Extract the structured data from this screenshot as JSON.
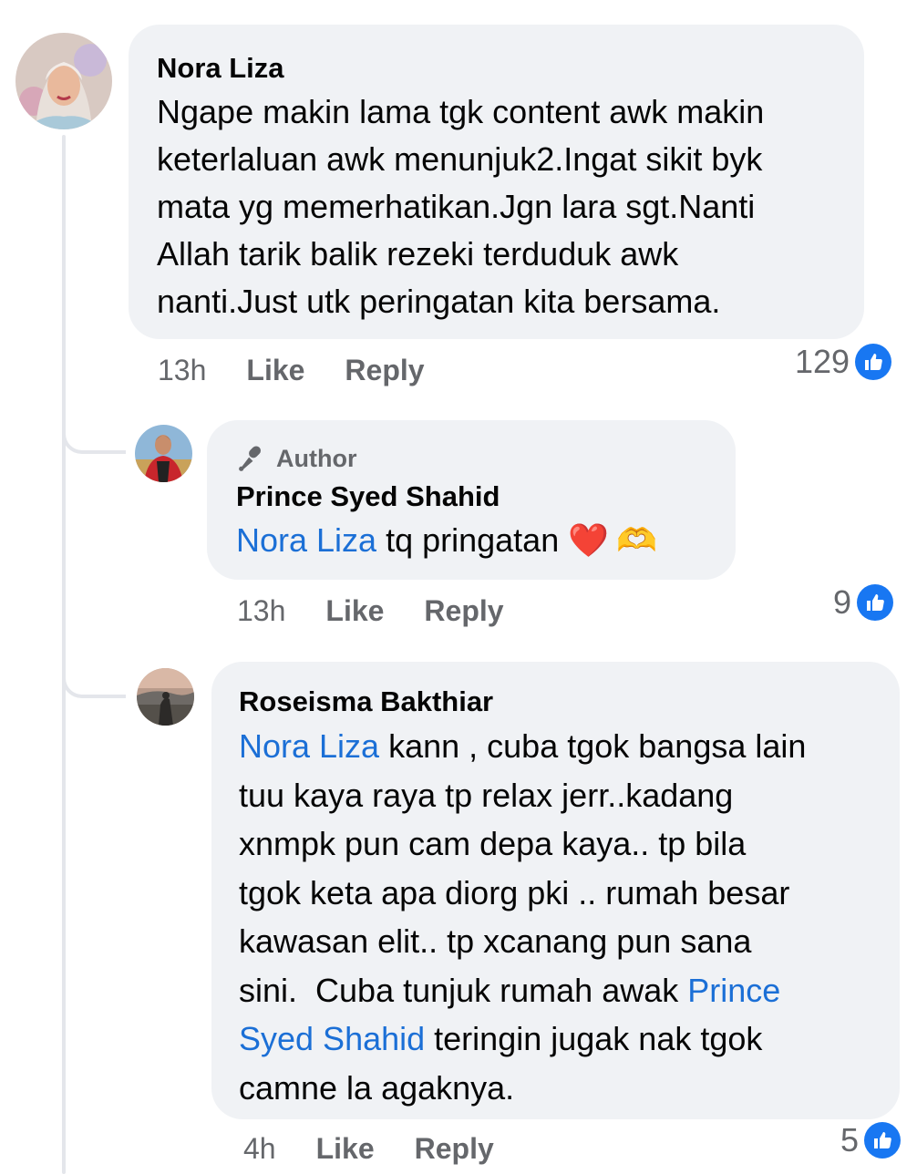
{
  "colors": {
    "bubble": "#f0f2f5",
    "mention": "#1b6fd6",
    "like_blue": "#1877f2",
    "meta": "#65676b"
  },
  "comments": [
    {
      "name": "Nora Liza",
      "lines": [
        "Ngape makin lama tgk content awk makin",
        "keterlaluan awk menunjuk2.Ingat sikit byk",
        "mata yg memerhatikan.Jgn lara sgt.Nanti",
        "Allah tarik balik rezeki terduduk awk",
        "nanti.Just utk peringatan kita bersama."
      ],
      "time": "13h",
      "like_label": "Like",
      "reply_label": "Reply",
      "reaction_count": "129"
    },
    {
      "badge": "Author",
      "badge_icon": "microphone-icon",
      "name": "Prince Syed Shahid",
      "mention": "Nora Liza",
      "text": " tq pringatan ",
      "emojis": [
        "❤️",
        "🫶"
      ],
      "time": "13h",
      "like_label": "Like",
      "reply_label": "Reply",
      "reaction_count": "9"
    },
    {
      "name": "Roseisma Bakthiar",
      "line1_mention": "Nora Liza",
      "line1_text": " kann , cuba tgok bangsa lain",
      "line2": "tuu kaya raya tp relax jerr..kadang",
      "line3": "xnmpk pun cam depa kaya.. tp bila",
      "line4": "tgok keta apa diorg pki .. rumah besar",
      "line5": "kawasan elit.. tp xcanang pun sana",
      "line6_text": "sini.  Cuba tunjuk rumah awak ",
      "line6_mention": "Prince",
      "line7_mention": "Syed Shahid",
      "line7_text": " teringin jugak nak tgok",
      "line8": "camne la agaknya.",
      "time": "4h",
      "like_label": "Like",
      "reply_label": "Reply",
      "reaction_count": "5"
    }
  ]
}
